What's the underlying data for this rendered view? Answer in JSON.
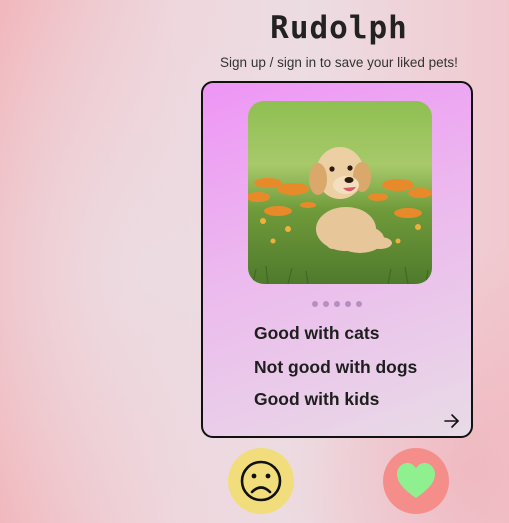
{
  "app": {
    "title": "Rudolph",
    "subtitle": "Sign up / sign in to save your liked pets!"
  },
  "pet_card": {
    "photo_icon": "puppy-photo",
    "carousel_dots": 5,
    "traits": [
      "Good with cats",
      "Not good with dogs",
      "Good with kids"
    ],
    "next_icon": "arrow-right-icon"
  },
  "actions": {
    "dislike_icon": "sad-face-icon",
    "like_icon": "heart-icon"
  },
  "colors": {
    "card_gradient_start": "#ee95f6",
    "card_gradient_end": "#e8dbe6",
    "dislike_button": "#f2dd7c",
    "like_button": "#f58e8a",
    "heart": "#8ef08e"
  }
}
